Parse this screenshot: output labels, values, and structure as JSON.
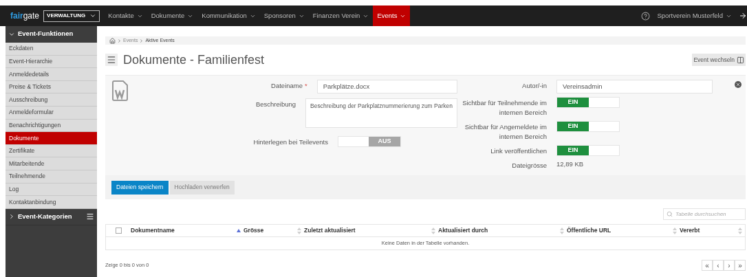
{
  "topbar": {
    "logo_a": "fair",
    "logo_b": "gate",
    "module": "VERWALTUNG",
    "menu": [
      {
        "label": "Kontakte",
        "selected": false
      },
      {
        "label": "Dokumente",
        "selected": false
      },
      {
        "label": "Kommunikation",
        "selected": false
      },
      {
        "label": "Sponsoren",
        "selected": false
      },
      {
        "label": "Finanzen Verein",
        "selected": false
      },
      {
        "label": "Events",
        "selected": true
      }
    ],
    "club": "Sportverein Musterfeld"
  },
  "sidebar": {
    "sections": [
      {
        "title": "Event-Funktionen",
        "expanded": true,
        "items": [
          {
            "label": "Eckdaten",
            "selected": false
          },
          {
            "label": "Event-Hierarchie",
            "selected": false
          },
          {
            "label": "Anmeldedetails",
            "selected": false
          },
          {
            "label": "Preise & Tickets",
            "selected": false
          },
          {
            "label": "Ausschreibung",
            "selected": false
          },
          {
            "label": "Anmeldeformular",
            "selected": false
          },
          {
            "label": "Benachrichtigungen",
            "selected": false
          },
          {
            "label": "Dokumente",
            "selected": true
          },
          {
            "label": "Zertifikate",
            "selected": false
          },
          {
            "label": "Mitarbeitende",
            "selected": false
          },
          {
            "label": "Teilnehmende",
            "selected": false
          },
          {
            "label": "Log",
            "selected": false
          },
          {
            "label": "Kontaktanbindung",
            "selected": false
          }
        ]
      },
      {
        "title": "Event-Kategorien",
        "expanded": false
      }
    ]
  },
  "breadcrumb": [
    "Events",
    "Aktive Events"
  ],
  "page_title": "Dokumente - Familienfest",
  "switch_button": "Event wechseln",
  "form": {
    "left": [
      {
        "kind": "input",
        "label": "Dateiname",
        "required_mark": "*",
        "value": "Parkplätze.docx"
      },
      {
        "kind": "textarea",
        "label": "Beschreibung",
        "value": "Beschreibung der Parkplatznummerierung zum Parken"
      },
      {
        "kind": "toggle",
        "label": "Hinterlegen bei Teilevents",
        "on": false,
        "text": "AUS"
      }
    ],
    "right": [
      {
        "kind": "input",
        "label": "Autor/-in",
        "value": "Vereinsadmin"
      },
      {
        "kind": "toggle",
        "label": "Sichtbar für Teilnehmende im internen Bereich",
        "on": true,
        "text": "EIN"
      },
      {
        "kind": "toggle",
        "label": "Sichtbar für Angemeldete im internen Bereich",
        "on": true,
        "text": "EIN"
      },
      {
        "kind": "toggle",
        "label": "Link veröffentlichen",
        "on": true,
        "text": "EIN"
      },
      {
        "kind": "static",
        "label": "Dateigrösse",
        "value": "12,89 KB"
      }
    ]
  },
  "buttons": [
    {
      "label": "Dateien speichern",
      "kind": "primary"
    },
    {
      "label": "Hochladen verwerfen",
      "kind": "secondary"
    }
  ],
  "table": {
    "search_placeholder": "Tabelle durchsuchen",
    "select_all_checked": false,
    "columns": [
      {
        "label": "Dokumentname",
        "sorted": true
      },
      {
        "label": "Grösse",
        "sorted": false
      },
      {
        "label": "Zuletzt aktualisiert",
        "sorted": false
      },
      {
        "label": "Aktualisiert durch",
        "sorted": false
      },
      {
        "label": "Öffentliche URL",
        "sorted": false
      },
      {
        "label": "Vererbt",
        "sorted": false
      }
    ],
    "empty": "Keine Daten in der Tabelle vorhanden.",
    "info": "Zeige 0 bis 0 von 0",
    "pager": [
      "«",
      "‹",
      "›",
      "»"
    ]
  }
}
